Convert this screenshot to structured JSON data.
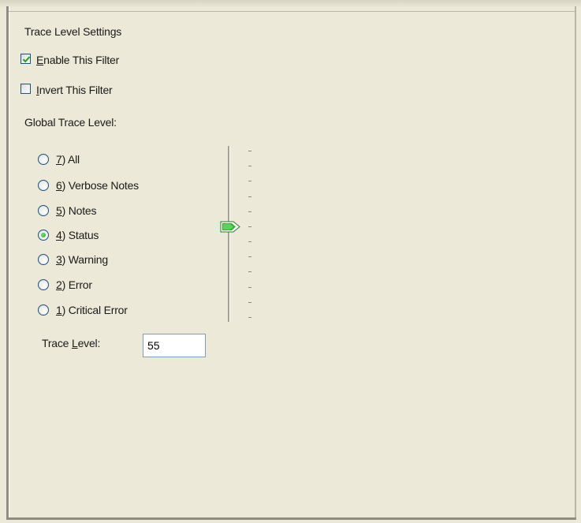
{
  "group": {
    "title": "Trace Level Settings"
  },
  "options": {
    "enable_filter": {
      "accel": "E",
      "rest": "nable This Filter",
      "checked": true
    },
    "invert_filter": {
      "accel": "I",
      "rest": "nvert This Filter",
      "checked": false
    }
  },
  "global_trace": {
    "label": "Global Trace Level:",
    "levels": [
      {
        "accel": "7",
        "rest": ") All",
        "selected": false
      },
      {
        "accel": "6",
        "rest": ") Verbose Notes",
        "selected": false
      },
      {
        "accel": "5",
        "rest": ") Notes",
        "selected": false
      },
      {
        "accel": "4",
        "rest": ") Status",
        "selected": true
      },
      {
        "accel": "3",
        "rest": ") Warning",
        "selected": false
      },
      {
        "accel": "2",
        "rest": ") Error",
        "selected": false
      },
      {
        "accel": "1",
        "rest": ") Critical Error",
        "selected": false
      }
    ],
    "slider_ticks": 12
  },
  "trace_level": {
    "label_pre": "Trace ",
    "label_accel": "L",
    "label_post": "evel:",
    "value": "55"
  },
  "colors": {
    "background": "#ece9d8",
    "control_border": "#1c5180",
    "check_mark": "#21a121",
    "thumb_fill": "#2cb52c"
  }
}
